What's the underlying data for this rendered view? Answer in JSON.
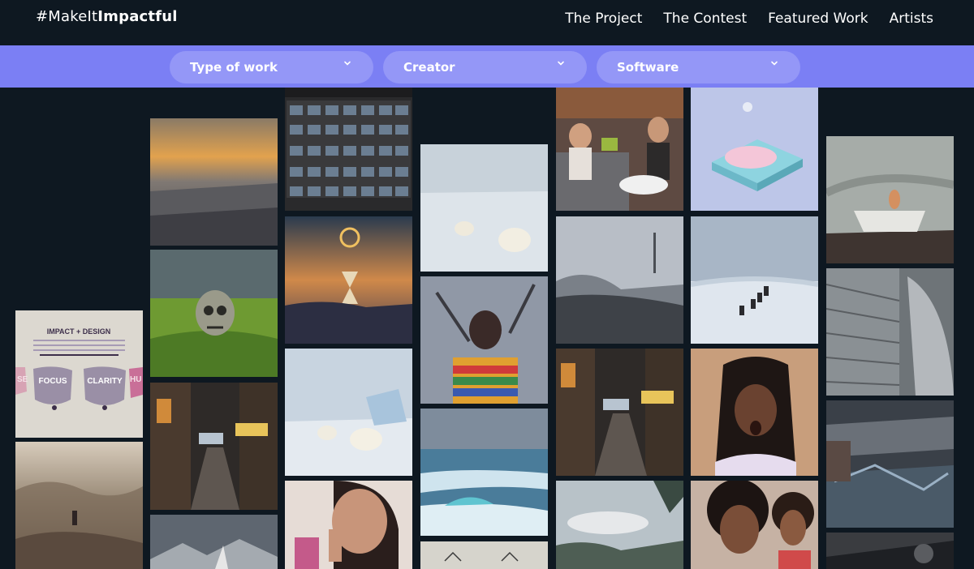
{
  "logo": {
    "prefix": "#MakeIt",
    "bold": "Impactful"
  },
  "nav": [
    {
      "label": "The Project"
    },
    {
      "label": "The Contest"
    },
    {
      "label": "Featured Work"
    },
    {
      "label": "Artists"
    }
  ],
  "filters": [
    {
      "label": "Type of work"
    },
    {
      "label": "Creator"
    },
    {
      "label": "Software"
    }
  ],
  "poster": {
    "title": "IMPACT + DESIGN",
    "body": "Digital technology renders everyone a maker—with greater power to create impact, but also greater potential to create noise. The most impactful digital experiences offer something more; connecting us to our human purpose.",
    "subhead": "Here are the core principles.",
    "pick1": "FOCUS",
    "pick2": "CLARITY",
    "edge_left": "SE",
    "edge_right": "HU"
  },
  "colors": {
    "background": "#0e1821",
    "filterbar": "#7b7ff4",
    "dropdown": "#9497f7"
  }
}
